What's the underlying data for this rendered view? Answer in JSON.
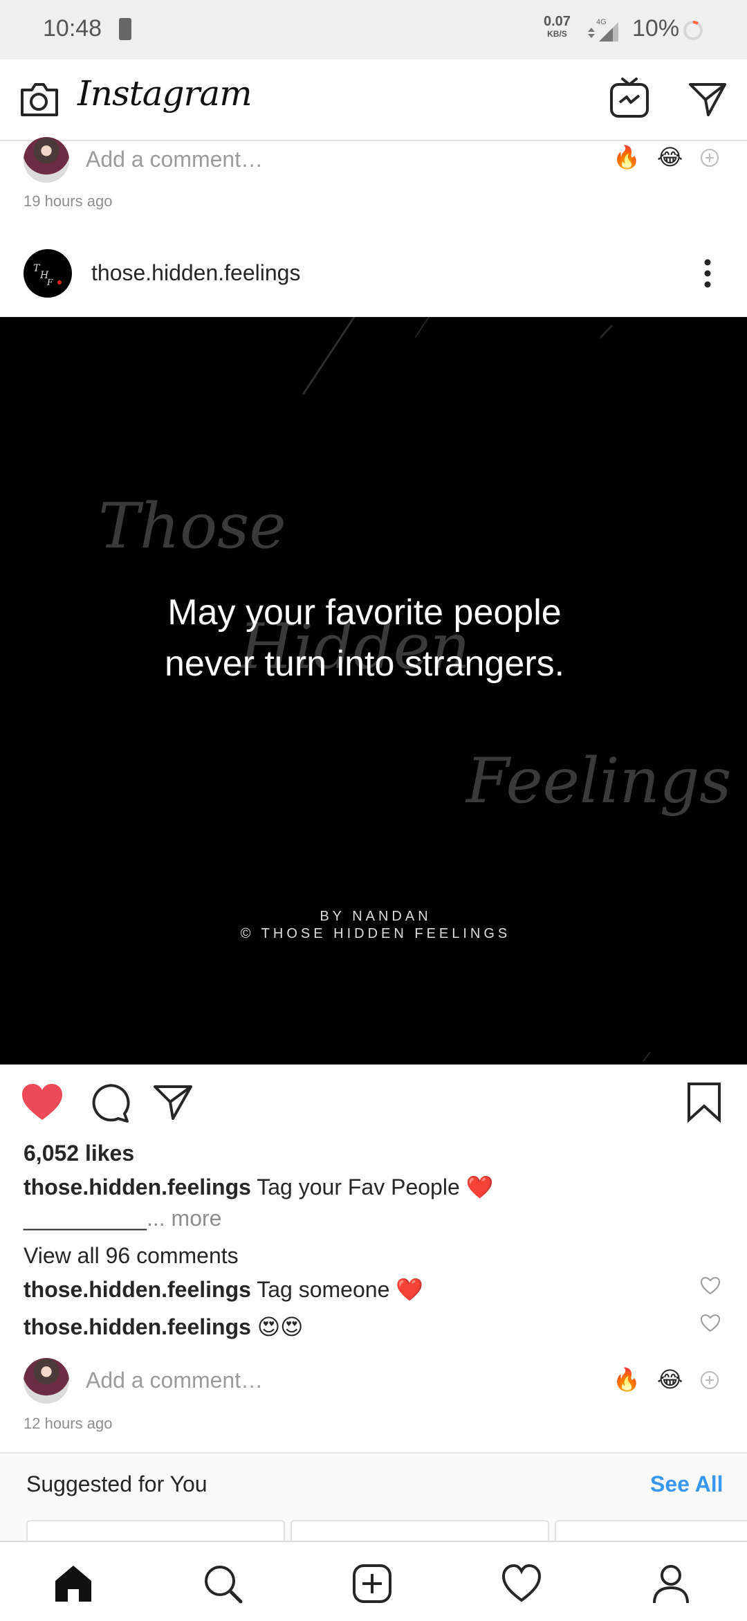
{
  "status_bar": {
    "time": "10:48",
    "net_speed": "0.07",
    "net_unit": "KB/S",
    "signal_type": "4G",
    "battery_pct": "10%"
  },
  "app_bar": {
    "title": "Instagram",
    "icons": [
      "camera-icon",
      "igtv-icon",
      "direct-message-icon"
    ]
  },
  "prev_post": {
    "comment_placeholder": "Add a comment…",
    "emoji_1": "🔥",
    "emoji_2": "😂",
    "timestamp": "19 hours ago"
  },
  "post": {
    "username": "those.hidden.feelings",
    "image": {
      "ghost_words": [
        "Those",
        "Hidden",
        "Feelings"
      ],
      "quote_line1": "May your favorite people",
      "quote_line2": "never turn into strangers.",
      "credit_line1": "BY NANDAN",
      "credit_line2": "© THOSE HIDDEN FEELINGS"
    },
    "likes": "6,052 likes",
    "caption_user": "those.hidden.feelings",
    "caption_text": "Tag your Fav People ❤️",
    "caption_line2": "__________",
    "caption_more": "... more",
    "view_all_comments": "View all 96 comments",
    "comments": [
      {
        "user": "those.hidden.feelings",
        "text": "Tag someone ❤️"
      },
      {
        "user": "those.hidden.feelings",
        "text": "😍😍"
      }
    ],
    "comment_placeholder": "Add a comment…",
    "emoji_1": "🔥",
    "emoji_2": "😂",
    "timestamp": "12 hours ago"
  },
  "suggested": {
    "title": "Suggested for You",
    "see_all": "See All"
  },
  "bottom_nav": [
    "home-icon",
    "search-icon",
    "new-post-icon",
    "activity-heart-icon",
    "profile-icon"
  ],
  "colors": {
    "like_red": "#ed4956",
    "link_blue": "#3897f0",
    "muted": "#8e8e8e"
  }
}
